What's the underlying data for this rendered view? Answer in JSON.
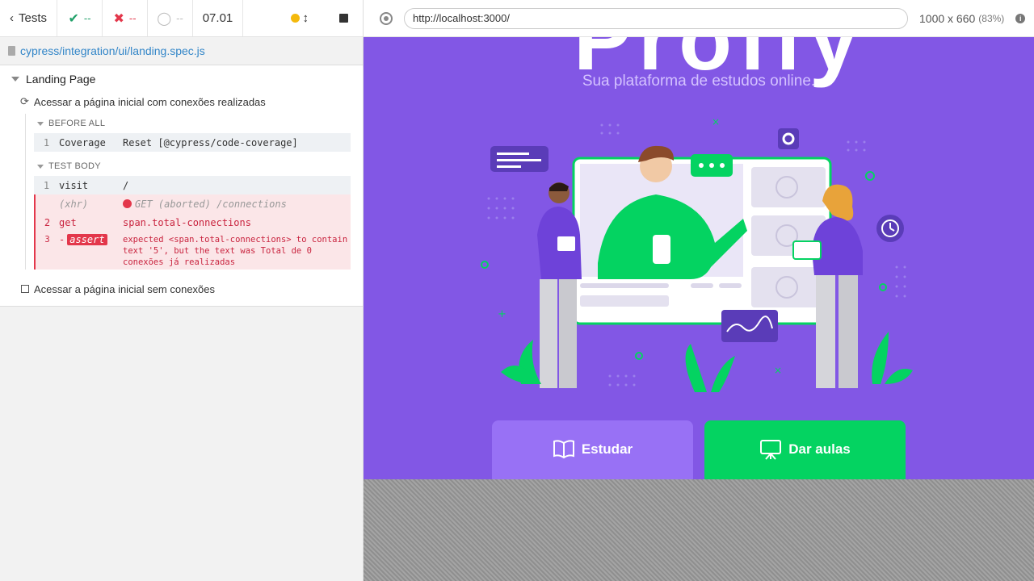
{
  "reporter": {
    "back_label": "Tests",
    "passed": "--",
    "failed": "--",
    "pending": "--",
    "duration": "07.01",
    "spec_path": "cypress/integration/ui/landing.spec.js",
    "suite_title": "Landing Page",
    "tests": [
      {
        "title": "Acessar a página inicial com conexões realizadas",
        "hooks": [
          {
            "title": "BEFORE ALL",
            "commands": [
              {
                "num": "1",
                "name": "Coverage",
                "msg": "Reset [@cypress/code-coverage]"
              }
            ]
          },
          {
            "title": "TEST BODY",
            "commands": [
              {
                "num": "1",
                "name": "visit",
                "msg": "/"
              },
              {
                "num": "",
                "name": "(xhr)",
                "msg": "GET (aborted) /connections"
              },
              {
                "num": "2",
                "name": "get",
                "msg": "span.total-connections"
              },
              {
                "num": "3",
                "name": "assert",
                "prefix": "-",
                "msg": "expected <span.total-connections> to contain text '5', but the text was Total de 0 conexões já realizadas"
              }
            ]
          }
        ]
      },
      {
        "title": "Acessar a página inicial sem conexões"
      }
    ]
  },
  "aut": {
    "url": "http://localhost:3000/",
    "viewport": "1000 x 660",
    "scale": "(83%)",
    "app": {
      "tagline": "Sua plataforma de estudos online.",
      "study_button": "Estudar",
      "give_classes_button": "Dar aulas",
      "brand_color": "#8257e5",
      "study_color": "#9871f5",
      "give_color": "#04d361"
    }
  }
}
